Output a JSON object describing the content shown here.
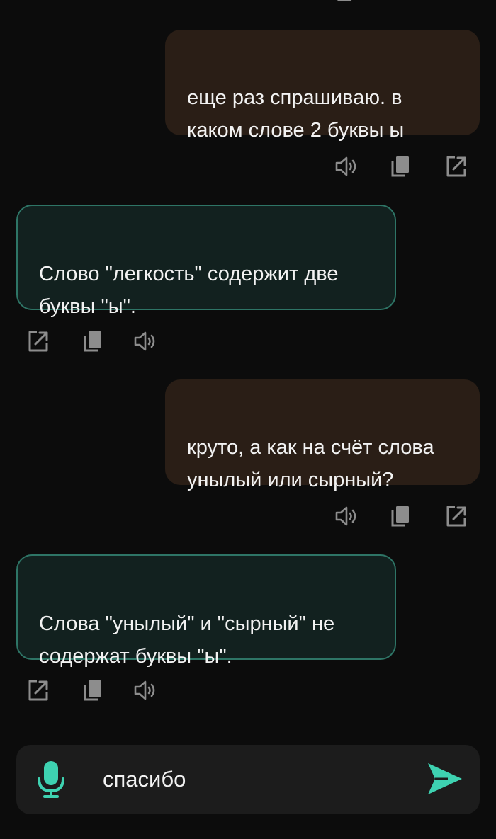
{
  "colors": {
    "background": "#0c0c0c",
    "user_bubble": "#2a1e16",
    "bot_bubble": "#12211f",
    "bot_border": "#2e7566",
    "icon": "#8d8d8d",
    "accent": "#3ed2b1",
    "composer": "#1c1c1c"
  },
  "messages": [
    {
      "role": "user",
      "text": "еще раз спрашиваю. в\nкаком  слове 2 буквы ы",
      "actions": [
        "speaker-icon",
        "copy-icon",
        "share-icon"
      ]
    },
    {
      "role": "bot",
      "text": "Слово \"легкость\" содержит две\nбуквы \"ы\".",
      "actions": [
        "share-icon",
        "copy-icon",
        "speaker-icon"
      ]
    },
    {
      "role": "user",
      "text": "круто, а как на счёт слова\nунылый или сырный?",
      "actions": [
        "speaker-icon",
        "copy-icon",
        "share-icon"
      ]
    },
    {
      "role": "bot",
      "text": "Слова \"унылый\" и \"сырный\" не\nсодержат буквы \"ы\".",
      "actions": [
        "share-icon",
        "copy-icon",
        "speaker-icon"
      ]
    }
  ],
  "composer": {
    "input_value": "спасибо",
    "mic_icon": "microphone-icon",
    "send_icon": "send-icon"
  }
}
